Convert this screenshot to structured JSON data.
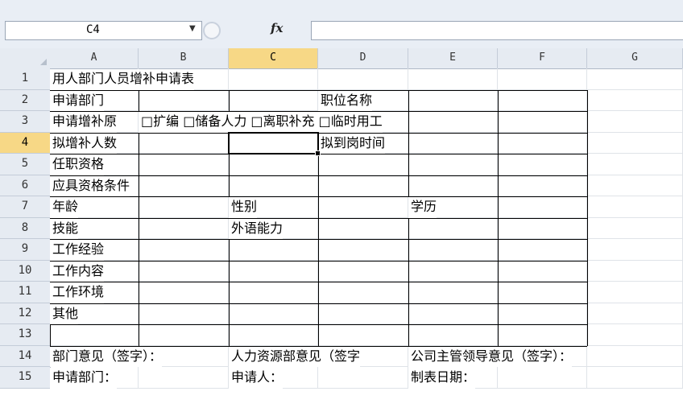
{
  "formula_bar": {
    "name_box": "C4",
    "fx_label": "fx",
    "formula": ""
  },
  "columns": [
    "A",
    "B",
    "C",
    "D",
    "E",
    "F",
    "G"
  ],
  "rows": [
    "1",
    "2",
    "3",
    "4",
    "5",
    "6",
    "7",
    "8",
    "9",
    "10",
    "11",
    "12",
    "13",
    "14",
    "15"
  ],
  "selected": {
    "column": "C",
    "row": "4"
  },
  "cells": {
    "A1": "用人部门人员增补申请表",
    "A2": "申请部门",
    "D2": "职位名称",
    "A3": "申请增补原",
    "B3": "□扩编 □储备人力 □离职补充 □临时用工",
    "A4": "拟增补人数",
    "D4": "拟到岗时间",
    "A5": "任职资格",
    "A6": "应具资格条件",
    "A7": "年龄",
    "C7": "性别",
    "E7": "学历",
    "A8": "技能",
    "C8": "外语能力",
    "A9": "工作经验",
    "A10": "工作内容",
    "A11": "工作环境",
    "A12": "其他",
    "A14": "部门意见（签字）：",
    "C14": "人力资源部意见（签字",
    "E14": "公司主管领导意见（签字）：",
    "A15": "申请部门：",
    "C15": "申请人：",
    "E15": "制表日期："
  }
}
